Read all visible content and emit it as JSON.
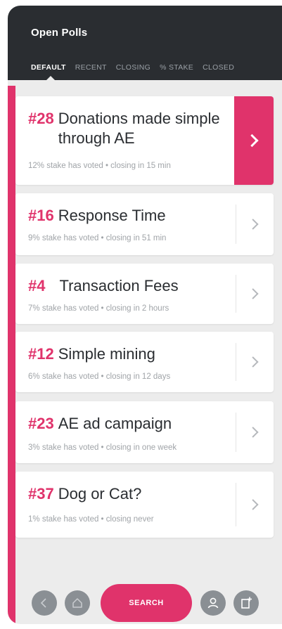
{
  "header": {
    "title": "Open Polls",
    "tabs": [
      {
        "label": "DEFAULT",
        "active": true
      },
      {
        "label": "RECENT",
        "active": false
      },
      {
        "label": "CLOSING",
        "active": false
      },
      {
        "label": "% STAKE",
        "active": false
      },
      {
        "label": "CLOSED",
        "active": false
      }
    ]
  },
  "polls": [
    {
      "number": "#28",
      "title": "Donations made simple through AE",
      "meta": "12% stake has voted • closing in 15 min",
      "selected": true
    },
    {
      "number": "#16",
      "title": "Response Time",
      "meta": "9% stake has voted • closing in 51 min",
      "selected": false
    },
    {
      "number": "#4",
      "title": "Transaction Fees",
      "meta": "7% stake has voted • closing in 2 hours",
      "selected": false
    },
    {
      "number": "#12",
      "title": "Simple mining",
      "meta": "6% stake has voted • closing in 12 days",
      "selected": false
    },
    {
      "number": "#23",
      "title": "AE ad campaign",
      "meta": "3% stake has voted • closing in one week",
      "selected": false
    },
    {
      "number": "#37",
      "title": "Dog or Cat?",
      "meta": "1% stake has voted • closing never",
      "selected": false
    }
  ],
  "bottom_bar": {
    "search_label": "SEARCH",
    "icons": [
      "back-icon",
      "home-icon",
      "account-icon",
      "new-poll-icon"
    ]
  },
  "colors": {
    "accent": "#e0336b",
    "header_bg": "#2a2d31",
    "background": "#ececec",
    "muted_icon": "#8a8f94"
  }
}
